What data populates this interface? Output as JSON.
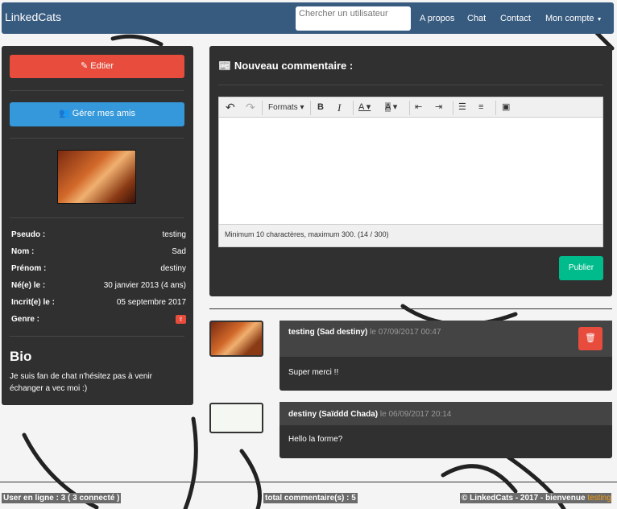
{
  "navbar": {
    "brand": "LinkedCats",
    "search_placeholder": "Chercher un utilisateur",
    "links": [
      "A propos",
      "Chat",
      "Contact",
      "Mon compte"
    ]
  },
  "sidebar": {
    "edit_label": "Edtier",
    "friends_label": "Gérer mes amis",
    "fields": [
      {
        "label": "Pseudo :",
        "value": "testing"
      },
      {
        "label": "Nom :",
        "value": "Sad"
      },
      {
        "label": "Prénom :",
        "value": "destiny"
      },
      {
        "label": "Né(e) le :",
        "value": "30 janvier 2013 (4 ans)"
      },
      {
        "label": "Incrit(e) le :",
        "value": "05 septembre 2017"
      },
      {
        "label": "Genre :",
        "value": "♀"
      }
    ],
    "bio_title": "Bio",
    "bio_text": "Je suis fan de chat n'hésitez pas à venir échanger a vec moi :)"
  },
  "composer": {
    "title": "Nouveau commentaire :",
    "formats_label": "Formats",
    "status": "Minimum 10 charactères, maximum 300. (14 / 300)",
    "publish_label": "Publier"
  },
  "comments": [
    {
      "author": "testing (Sad destiny)",
      "date": "le 07/09/2017 00:47",
      "text": "Super merci !!"
    },
    {
      "author": "destiny (Saïddd Chada)",
      "date": "le 06/09/2017 20:14",
      "text": "Hello la forme?"
    }
  ],
  "footer": {
    "online": "User en ligne : 3 ( 3 connecté )",
    "total": "total commentaire(s) : 5",
    "copyright": "© LinkedCats - 2017  -  bienvenue",
    "user": "testing"
  },
  "colors": {
    "nav": "#375a7f",
    "danger": "#e74c3c",
    "info": "#3498db",
    "success": "#00bc8c",
    "panel": "#303030"
  }
}
